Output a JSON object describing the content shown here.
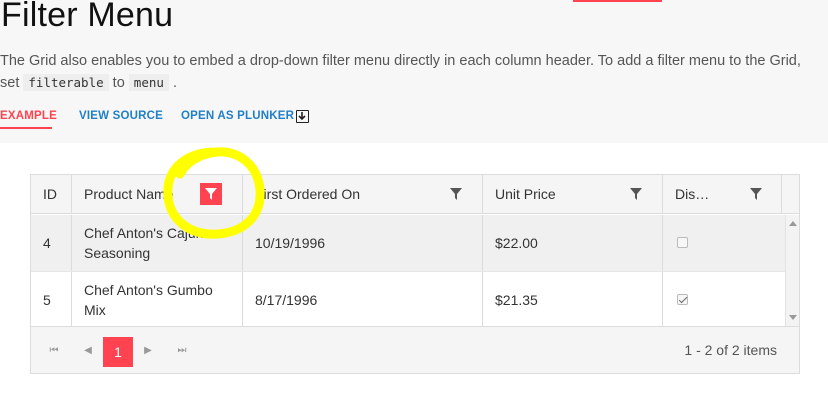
{
  "page": {
    "title": "Filter Menu",
    "description_prefix": "The Grid also enables you to embed a drop-down filter menu directly in each column header. To add a filter menu to the Grid,",
    "description_set": "set",
    "code_filterable": "filterable",
    "description_to": "to",
    "code_menu": "menu",
    "description_end": "."
  },
  "tabs": {
    "example": "EXAMPLE",
    "view_source": "VIEW SOURCE",
    "open_plunker": "OPEN AS PLUNKER"
  },
  "grid": {
    "columns": [
      "ID",
      "Product Name",
      "First Ordered On",
      "Unit Price",
      "Dis…"
    ],
    "rows": [
      {
        "id": "4",
        "name_line1": "Chef Anton's Cajun",
        "name_line2": "Seasoning",
        "date": "10/19/1996",
        "price": "$22.00",
        "discontinued": false
      },
      {
        "id": "5",
        "name_line1": "Chef Anton's Gumbo",
        "name_line2": "Mix",
        "date": "8/17/1996",
        "price": "$21.35",
        "discontinued": true
      }
    ],
    "pager": {
      "first_icon": "⏮",
      "prev_icon": "◀",
      "current_page": "1",
      "next_icon": "▶",
      "last_icon": "⏭",
      "info": "1 - 2 of 2 items"
    }
  },
  "colors": {
    "accent": "#ff4350",
    "link": "#1f7fc7",
    "highlight": "#ffff00"
  },
  "icons": {
    "filter": "filter-icon",
    "download": "download-icon"
  }
}
